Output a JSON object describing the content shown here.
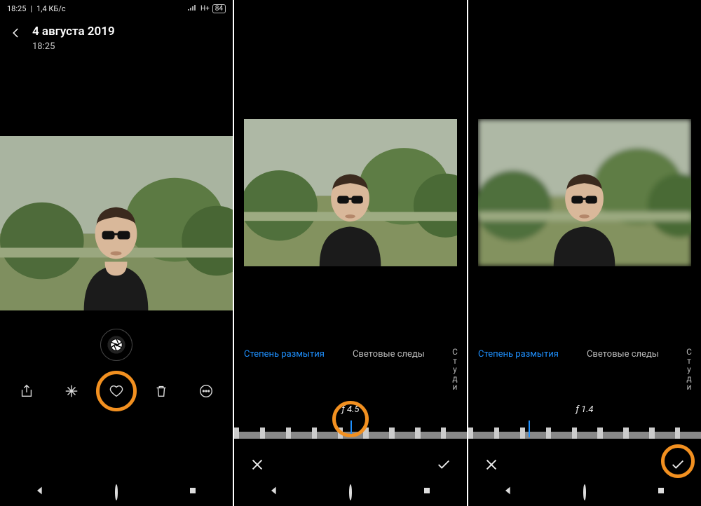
{
  "statusbar": {
    "time": "18:25",
    "speed": "1,4 КБ/с",
    "network": "H+",
    "battery": "84"
  },
  "panel1": {
    "date": "4 августа 2019",
    "time": "18:25"
  },
  "editor": {
    "tab_blur": "Степень размытия",
    "tab_light": "Световые следы",
    "tab_studio_chars": [
      "С",
      "т",
      "у",
      "д",
      "и"
    ]
  },
  "editor_a": {
    "fstop": "ƒ 4.5",
    "marker_pct": 50
  },
  "editor_b": {
    "fstop": "ƒ 1.4",
    "marker_pct": 26
  },
  "highlights": {
    "aperture": true,
    "ruler_a": true,
    "confirm_b": true
  }
}
